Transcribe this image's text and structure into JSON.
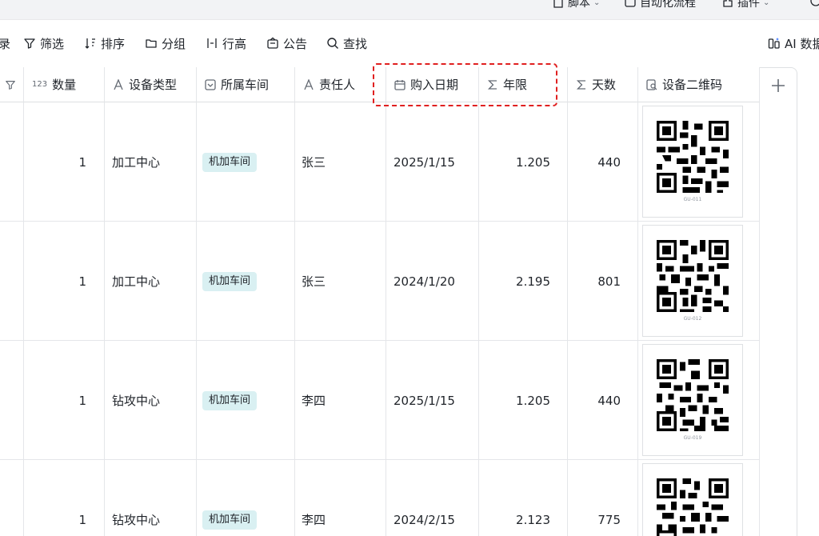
{
  "topbar": {
    "script_label": "脚本",
    "automation_label": "自动化流程",
    "plugin_label": "插件"
  },
  "toolbar": {
    "record_fragment": "录",
    "filter_label": "筛选",
    "sort_label": "排序",
    "group_label": "分组",
    "row_height_label": "行高",
    "notice_label": "公告",
    "find_label": "查找",
    "ai_label": "AI 数据"
  },
  "columns": {
    "quantity_type": "123",
    "quantity": "数量",
    "device_type": "设备类型",
    "workshop": "所属车间",
    "owner": "责任人",
    "purchase_date": "购入日期",
    "years": "年限",
    "days": "天数",
    "qr": "设备二维码"
  },
  "rows": [
    {
      "quantity": "1",
      "device_type": "加工中心",
      "workshop": "机加车间",
      "owner": "张三",
      "purchase_date": "2025/1/15",
      "years": "1.205",
      "days": "440",
      "qr_code": "GU-011"
    },
    {
      "quantity": "1",
      "device_type": "加工中心",
      "workshop": "机加车间",
      "owner": "张三",
      "purchase_date": "2024/1/20",
      "years": "2.195",
      "days": "801",
      "qr_code": "GU-012"
    },
    {
      "quantity": "1",
      "device_type": "钻攻中心",
      "workshop": "机加车间",
      "owner": "李四",
      "purchase_date": "2025/1/15",
      "years": "1.205",
      "days": "440",
      "qr_code": "GU-019"
    },
    {
      "quantity": "1",
      "device_type": "钻攻中心",
      "workshop": "机加车间",
      "owner": "李四",
      "purchase_date": "2024/2/15",
      "years": "2.123",
      "days": "775",
      "qr_code": ""
    }
  ],
  "colors": {
    "tag_bg": "#d9f0f2",
    "highlight_border": "#e02020",
    "grid_line": "#e4e6e9"
  }
}
